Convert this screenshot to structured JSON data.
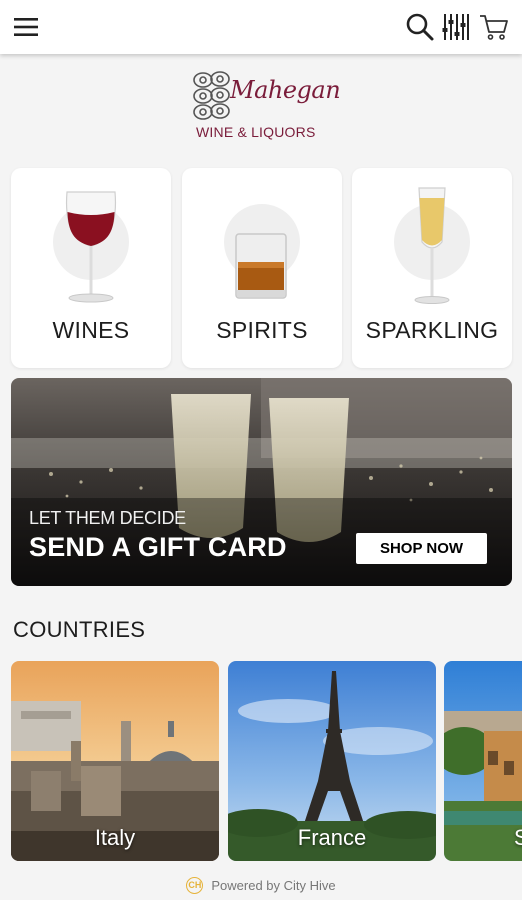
{
  "header": {
    "menu_icon": "hamburger-menu-icon",
    "search_icon": "search-icon",
    "filter_icon": "filter-sliders-icon",
    "cart_icon": "cart-icon"
  },
  "logo": {
    "script_text": "Mahegan",
    "subtitle": "WINE & LIQUORS",
    "icon": "wine-barrel-logo-icon",
    "brand_color": "#7a1c3a"
  },
  "categories": [
    {
      "label": "WINES",
      "icon": "red-wine-glass-icon"
    },
    {
      "label": "SPIRITS",
      "icon": "whiskey-glass-icon"
    },
    {
      "label": "SPARKLING",
      "icon": "champagne-flute-icon"
    }
  ],
  "banner": {
    "kicker": "LET THEM DECIDE",
    "headline": "SEND A GIFT CARD",
    "cta": "SHOP NOW"
  },
  "countries_section": {
    "title": "COUNTRIES",
    "items": [
      {
        "name": "Italy"
      },
      {
        "name": "France"
      },
      {
        "name": "S"
      }
    ]
  },
  "footer": {
    "powered_by": "Powered by City Hive",
    "logo_mark": "CH"
  }
}
